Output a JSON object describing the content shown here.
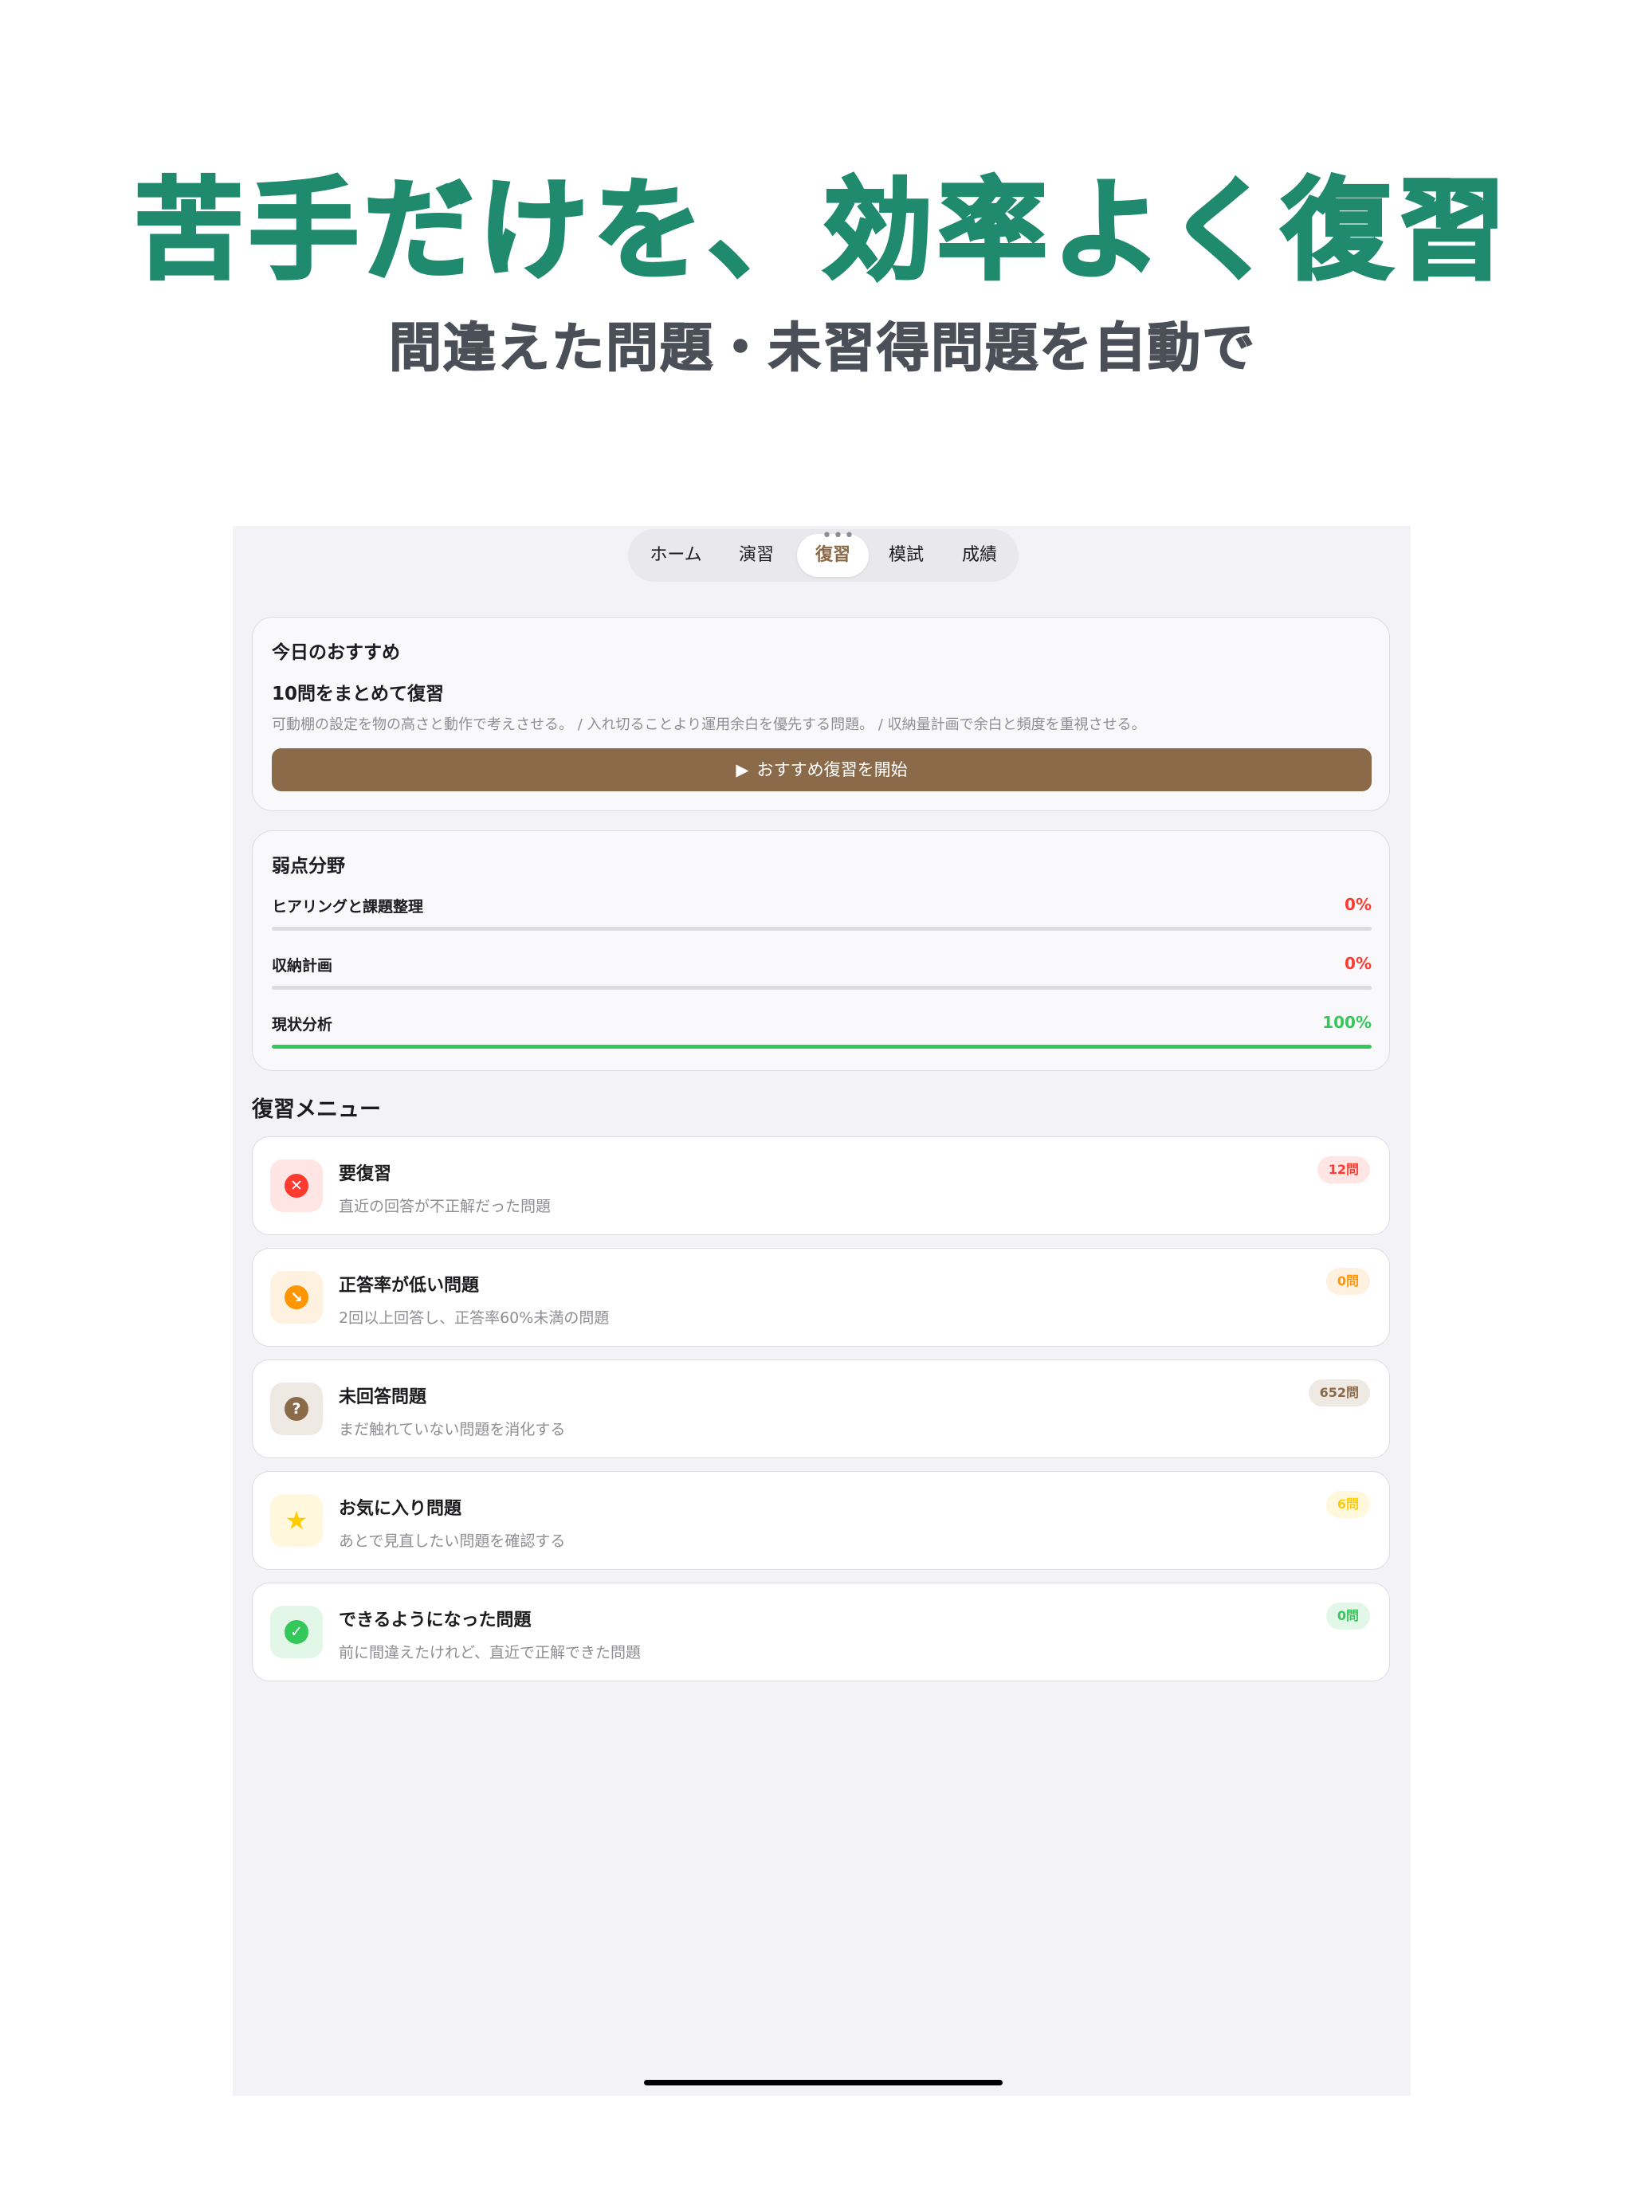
{
  "promo": {
    "headline": "苦手だけを、効率よく復習",
    "subheadline": "間違えた問題・未習得問題を自動で"
  },
  "tabs": [
    {
      "label": "ホーム"
    },
    {
      "label": "演習"
    },
    {
      "label": "復習"
    },
    {
      "label": "模試"
    },
    {
      "label": "成績"
    }
  ],
  "tab_more_glyph": "•••",
  "recommend": {
    "title": "今日のおすすめ",
    "headline": "10問をまとめて復習",
    "description": "可動棚の設定を物の高さと動作で考えさせる。 / 入れ切ることより運用余白を優先する問題。 / 収納量計画で余白と頻度を重視させる。",
    "button_label": "おすすめ復習を開始",
    "button_icon_glyph": "▶"
  },
  "weak_areas": {
    "title": "弱点分野",
    "items": [
      {
        "label": "ヒアリングと課題整理",
        "percent_text": "0%",
        "value": 0,
        "color": "#ff3b30"
      },
      {
        "label": "収納計画",
        "percent_text": "0%",
        "value": 0,
        "color": "#ff3b30"
      },
      {
        "label": "現状分析",
        "percent_text": "100%",
        "value": 100,
        "color": "#34c759"
      }
    ]
  },
  "review_menu": {
    "title": "復習メニュー",
    "items": [
      {
        "title": "要復習",
        "description": "直近の回答が不正解だった問題",
        "badge": "12問",
        "icon": "x-circle-icon",
        "glyph": "✕",
        "icon_color": "#ff3b30",
        "icon_bg": "#ffe5e3",
        "badge_color": "#ff3b30",
        "badge_bg": "#ffe5e3"
      },
      {
        "title": "正答率が低い問題",
        "description": "2回以上回答し、正答率60%未満の問題",
        "badge": "0問",
        "icon": "chart-down-icon",
        "glyph": "↘",
        "icon_color": "#ff9500",
        "icon_bg": "#fff1e0",
        "badge_color": "#ff9500",
        "badge_bg": "#fff1e0"
      },
      {
        "title": "未回答問題",
        "description": "まだ触れていない問題を消化する",
        "badge": "652問",
        "icon": "question-circle-icon",
        "glyph": "?",
        "icon_color": "#8b6a4a",
        "icon_bg": "#efe9e3",
        "badge_color": "#8b6a4a",
        "badge_bg": "#efe9e3"
      },
      {
        "title": "お気に入り問題",
        "description": "あとで見直したい問題を確認する",
        "badge": "6問",
        "icon": "star-icon",
        "glyph": "★",
        "icon_color": "#ffcc00",
        "icon_bg": "#fff8dc",
        "badge_color": "#ffcc00",
        "badge_bg": "#fff8dc"
      },
      {
        "title": "できるようになった問題",
        "description": "前に間違えたけれど、直近で正解できた問題",
        "badge": "0問",
        "icon": "check-seal-icon",
        "glyph": "✓",
        "icon_color": "#34c759",
        "icon_bg": "#e3f7e8",
        "badge_color": "#34c759",
        "badge_bg": "#e3f7e8"
      }
    ]
  }
}
